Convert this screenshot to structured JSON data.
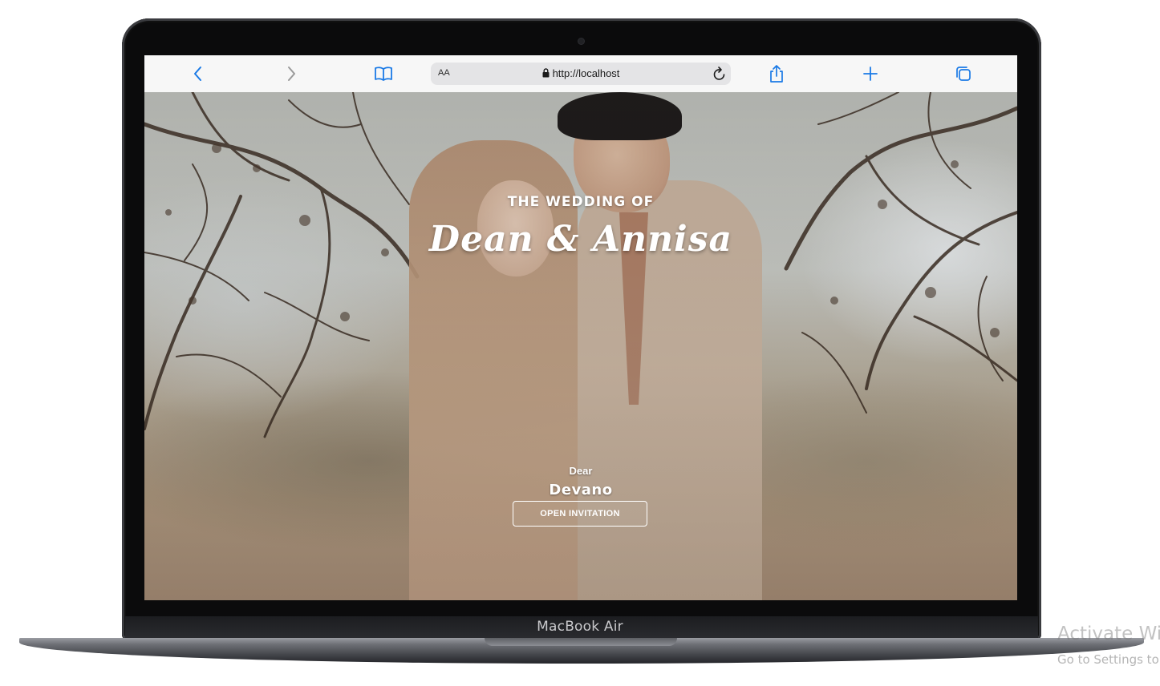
{
  "device": {
    "label": "MacBook Air"
  },
  "browser": {
    "text_size_label": "AA",
    "url": "http://localhost",
    "icons": {
      "back": "chevron-left-icon",
      "forward": "chevron-right-icon",
      "bookmarks": "book-icon",
      "lock": "lock-icon",
      "reload": "reload-icon",
      "share": "share-icon",
      "new_tab": "plus-icon",
      "tabs": "tabs-icon"
    },
    "accent_color": "#1a7ae6"
  },
  "hero": {
    "subtitle": "THE WEDDING OF",
    "names": "Dean & Annisa",
    "greeting": "Dear",
    "guest_name": "Devano",
    "button_label": "OPEN INVITATION"
  },
  "watermark": {
    "line1": "Activate Wi",
    "line2": "Go to Settings to"
  }
}
